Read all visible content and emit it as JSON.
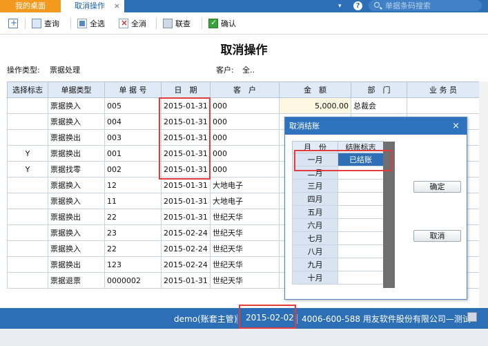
{
  "tabs": {
    "home_label": "我的桌面",
    "active_label": "取消操作",
    "close_glyph": "×",
    "menu_arrow": "▾",
    "help_glyph": "?",
    "search_placeholder": "单据条码搜索"
  },
  "toolbar": {
    "query": "查询",
    "select_all": "全选",
    "unselect_all": "全消",
    "audit": "联查",
    "confirm": "确认"
  },
  "page_title": "取消操作",
  "info": {
    "op_type_label": "操作类型:",
    "op_type_value": "票据处理",
    "customer_label": "客户:",
    "customer_value": "全.."
  },
  "table": {
    "headers": [
      "选择标志",
      "单据类型",
      "单 据 号",
      "日　期",
      "客　户",
      "金　额",
      "部　门",
      "业 务 员"
    ],
    "rows": [
      {
        "sel": "",
        "type": "票据换入",
        "no": "005",
        "date": "2015-01-31",
        "customer": "000",
        "amount": "5,000.00",
        "dept": "总裁会",
        "staff": ""
      },
      {
        "sel": "",
        "type": "票据换入",
        "no": "004",
        "date": "2015-01-31",
        "customer": "000",
        "amount": "",
        "dept": "",
        "staff": ""
      },
      {
        "sel": "",
        "type": "票据换出",
        "no": "003",
        "date": "2015-01-31",
        "customer": "000",
        "amount": "",
        "dept": "",
        "staff": ""
      },
      {
        "sel": "Y",
        "type": "票据换出",
        "no": "001",
        "date": "2015-01-31",
        "customer": "000",
        "amount": "",
        "dept": "",
        "staff": ""
      },
      {
        "sel": "Y",
        "type": "票据找零",
        "no": "002",
        "date": "2015-01-31",
        "customer": "000",
        "amount": "",
        "dept": "",
        "staff": ""
      },
      {
        "sel": "",
        "type": "票据换入",
        "no": "12",
        "date": "2015-01-31",
        "customer": "大地电子",
        "amount": "",
        "dept": "",
        "staff": ""
      },
      {
        "sel": "",
        "type": "票据换入",
        "no": "11",
        "date": "2015-01-31",
        "customer": "大地电子",
        "amount": "",
        "dept": "",
        "staff": ""
      },
      {
        "sel": "",
        "type": "票据换出",
        "no": "22",
        "date": "2015-01-31",
        "customer": "世纪天华",
        "amount": "",
        "dept": "",
        "staff": ""
      },
      {
        "sel": "",
        "type": "票据换入",
        "no": "23",
        "date": "2015-02-24",
        "customer": "世纪天华",
        "amount": "",
        "dept": "",
        "staff": ""
      },
      {
        "sel": "",
        "type": "票据换入",
        "no": "22",
        "date": "2015-02-24",
        "customer": "世纪天华",
        "amount": "",
        "dept": "",
        "staff": ""
      },
      {
        "sel": "",
        "type": "票据换出",
        "no": "123",
        "date": "2015-02-24",
        "customer": "世纪天华",
        "amount": "",
        "dept": "",
        "staff": ""
      },
      {
        "sel": "",
        "type": "票据退票",
        "no": "0000002",
        "date": "2015-01-31",
        "customer": "世纪天华",
        "amount": "",
        "dept": "",
        "staff": ""
      }
    ]
  },
  "dialog": {
    "title": "取消结账",
    "close_glyph": "×",
    "col_month": "月　份",
    "col_flag": "结账标志",
    "months": [
      {
        "month": "一月",
        "flag": "已结账"
      },
      {
        "month": "二月",
        "flag": ""
      },
      {
        "month": "三月",
        "flag": ""
      },
      {
        "month": "四月",
        "flag": ""
      },
      {
        "month": "五月",
        "flag": ""
      },
      {
        "month": "六月",
        "flag": ""
      },
      {
        "month": "七月",
        "flag": ""
      },
      {
        "month": "八月",
        "flag": ""
      },
      {
        "month": "九月",
        "flag": ""
      },
      {
        "month": "十月",
        "flag": ""
      }
    ],
    "ok_label": "确定",
    "cancel_label": "取消"
  },
  "status": {
    "user": "demo(账套主管)",
    "date": "2015-02-02",
    "company": "4006-600-588 用友软件股份有限公司—测试"
  },
  "colors": {
    "brand_blue": "#2d6fb7",
    "home_tab_orange": "#f39a1e",
    "highlight_red": "#e23b3b",
    "closed_cell": "#2f6fb5"
  }
}
